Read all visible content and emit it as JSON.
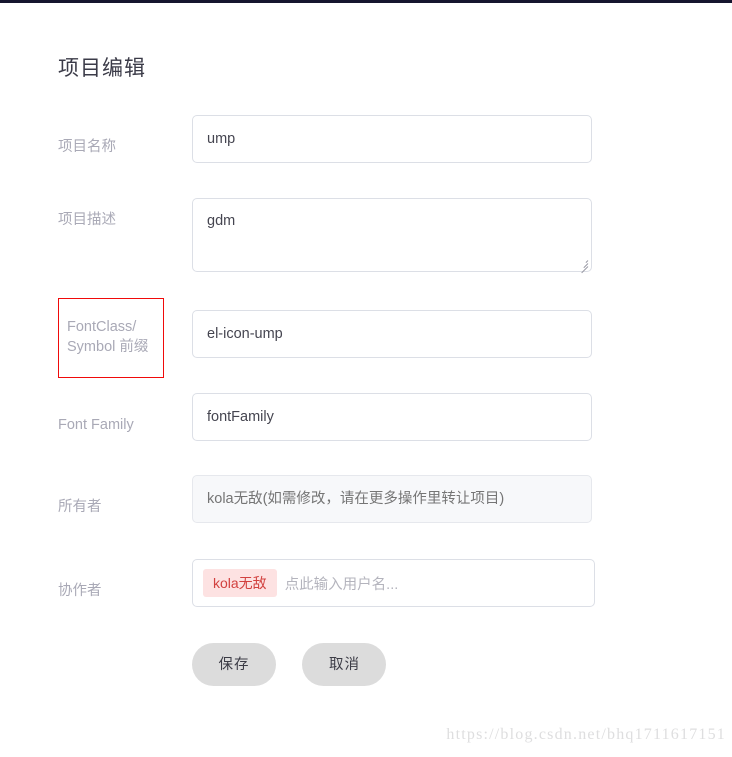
{
  "page": {
    "title": "项目编辑",
    "accent_red": "#f00a0a",
    "top_strip_color": "#16152e",
    "label_color": "#a9a9b6"
  },
  "form": {
    "rows": [
      {
        "label": "项目名称",
        "value": "ump",
        "type": "input"
      },
      {
        "label": "项目描述",
        "value": "gdm",
        "type": "textarea"
      },
      {
        "label": "FontClass/\nSymbol 前缀",
        "label_line1": "FontClass/",
        "label_line2": "Symbol 前缀",
        "value": "el-icon-ump",
        "type": "input",
        "highlighted": true
      },
      {
        "label": "Font Family",
        "value": "fontFamily",
        "type": "input"
      },
      {
        "label": "所有者",
        "value": "",
        "placeholder": "kola无敌(如需修改，请在更多操作里转让项目)",
        "type": "input-disabled"
      },
      {
        "label": "协作者",
        "tags": [
          "kola无敌"
        ],
        "placeholder": "点此输入用户名...",
        "type": "tags"
      }
    ]
  },
  "buttons": {
    "save_label": "保存",
    "cancel_label": "取消"
  },
  "watermark": {
    "text": "https://blog.csdn.net/bhq1711617151"
  }
}
